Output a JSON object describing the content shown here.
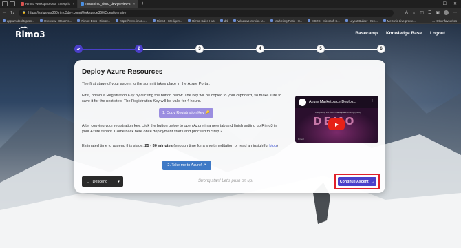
{
  "browser": {
    "tabs": [
      {
        "label": "Rimo3 Workspace360: Enterpris",
        "active": false
      },
      {
        "label": "rimo3.rimo_cloud_dev-preview-2",
        "active": true
      }
    ],
    "url": "https://sirius.ws360.rimo3dev.com/Workspace360/Questionnaire",
    "bookmarks": [
      "appium-desktop/scr...",
      "Overview - Observa...",
      "Rimo3 Docs | Rimo3...",
      "https://www.rimo3.c...",
      "Rimo3 - Intelligent...",
      "Rimo3 Sales Hub",
      "dnl",
      "Windows Version N...",
      "Marketing Flash - H...",
      "MSRC - Microsoft S...",
      "Layout Builder | Kee...",
      "Metronic Live previe..."
    ],
    "other_favourites": "Other favourites"
  },
  "app": {
    "logo": "Rimo3",
    "nav": [
      "Basecamp",
      "Knowledge Base",
      "Logout"
    ]
  },
  "stepper": {
    "steps": [
      "",
      "2",
      "3",
      "4",
      "5",
      "6"
    ],
    "current": 2
  },
  "card": {
    "title": "Deploy Azure Resources",
    "p1": "The first stage of your ascent to the summit takes place in the Azure Portal.",
    "p2": "First, obtain a Registration Key by clicking the button below. The key will be copied to your clipboard, so make sure to save it for the next step! The Registration Key will be valid for 4 hours.",
    "copy_button": "1. Copy Registration Key",
    "p3": "After copying your registration key, click the button below to open Azure in a new tab and finish setting up Rimo3 in your Azure tenant. Come back here once deployment starts and proceed to Step 2.",
    "p4_prefix": "Estimated time to ascend this stage: ",
    "p4_bold": "25 - 30 minutes",
    "p4_suffix": " (enough time for a short meditation or read an insightful ",
    "p4_link": "blog",
    "p4_end": ")",
    "azure_button": "2. Take me to Azure!",
    "descend_button": "Descend",
    "encourage": "Strong start! Let's push on up!",
    "continue_button": "Continue Ascent!"
  },
  "video": {
    "title": "Azure Marketplace Deploy...",
    "subtitle": "Completing the Azure Marketplace offering (MPO)",
    "demo_text": "DEMO",
    "brand": "Rimo3"
  },
  "colors": {
    "accent": "#4b3fc9",
    "highlight_border": "#e0202a",
    "azure_button": "#3e79c6"
  }
}
